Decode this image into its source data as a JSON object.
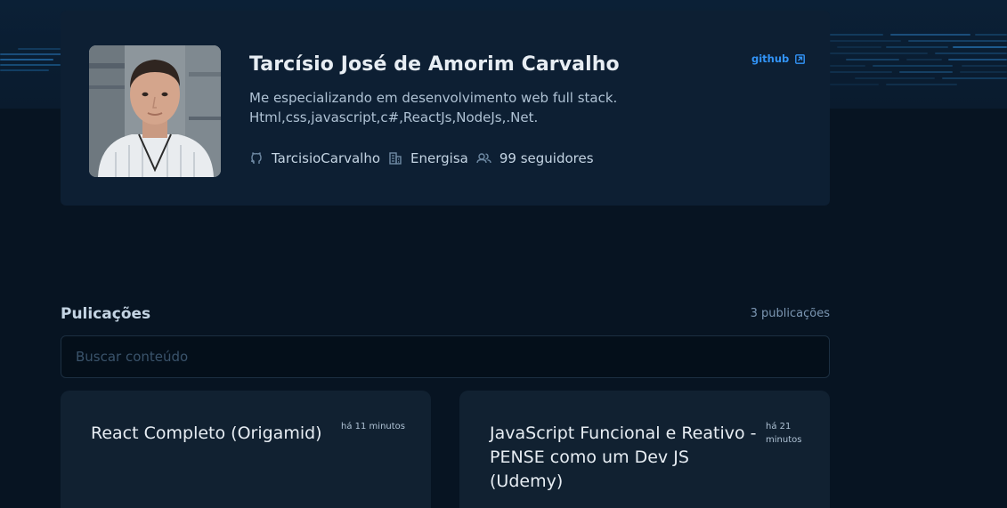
{
  "profile": {
    "name": "Tarcísio José de Amorim Carvalho",
    "github_label": "github",
    "bio_line1": "Me especializando em desenvolvimento web full stack.",
    "bio_line2": "Html,css,javascript,c#,ReactJs,NodeJs,.Net.",
    "username": "TarcisioCarvalho",
    "company": "Energisa",
    "followers": "99 seguidores",
    "icons": {
      "github": "external-link-icon",
      "username": "github-icon",
      "company": "building-icon",
      "followers": "users-icon"
    }
  },
  "publications": {
    "title": "Pulicações",
    "count": "3 publicações",
    "search_placeholder": "Buscar conteúdo",
    "posts": [
      {
        "title": "React Completo (Origamid)",
        "time": "há 11 minutos"
      },
      {
        "title": "JavaScript Funcional e Reativo - PENSE como um Dev JS (Udemy)",
        "time": "há 21 minutos"
      }
    ]
  },
  "colors": {
    "background": "#071422",
    "card": "#0d1f33",
    "post_card": "#112131",
    "accent": "#3294f8",
    "title_text": "#e7edf3",
    "body_text": "#afc2d4"
  }
}
